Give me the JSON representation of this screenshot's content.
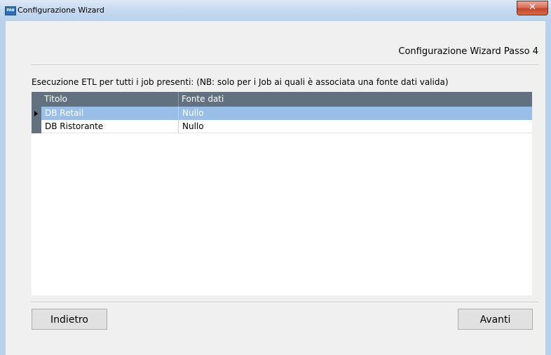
{
  "window": {
    "title": "Configurazione Wizard",
    "app_icon_label": "PAN",
    "close_glyph": "✕"
  },
  "header": {
    "step_title": "Configurazione Wizard Passo 4"
  },
  "instruction": "Esecuzione ETL per tutti i job presenti:  (NB: solo per i Job ai quali è associata una fonte dati valida)",
  "grid": {
    "columns": [
      "Titolo",
      "Fonte dati"
    ],
    "rows": [
      {
        "titolo": "DB Retail",
        "fonte": "Nullo",
        "selected": true
      },
      {
        "titolo": "DB Ristorante",
        "fonte": "Nullo",
        "selected": false
      }
    ]
  },
  "buttons": {
    "back": "Indietro",
    "next": "Avanti"
  },
  "colors": {
    "grid_header": "#62717f",
    "selected_row": "#99bfe8",
    "dialog_bg": "#f0f0f0",
    "close_button": "#c2472c"
  }
}
